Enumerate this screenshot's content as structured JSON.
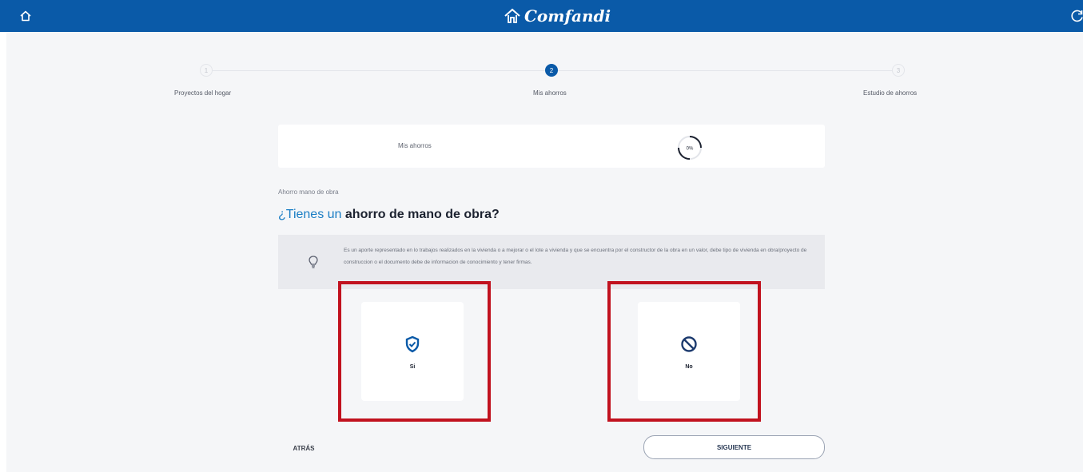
{
  "app": {
    "logo_text": "Comfandi",
    "brand_color": "#0a5aa8",
    "accent_color": "#1a7dc4",
    "highlight_color": "#c1121f"
  },
  "header": {
    "home_icon": "home-icon",
    "refresh_icon": "refresh-icon"
  },
  "stepper": {
    "steps": [
      {
        "number": "1",
        "label": "Proyectos del hogar",
        "state": "pending"
      },
      {
        "number": "2",
        "label": "Mis ahorros",
        "state": "active"
      },
      {
        "number": "3",
        "label": "Estudio de ahorros",
        "state": "pending"
      }
    ]
  },
  "progress": {
    "label": "Mis ahorros",
    "value_text": "0%",
    "fraction": 0.0
  },
  "section": {
    "label": "Ahorro mano de obra",
    "question_highlight": "¿Tienes un",
    "question_rest": " ahorro de mano de obra?"
  },
  "tip": {
    "icon": "lightbulb-icon",
    "text": "Es un aporte representado en lo trabajos realizados en la vivienda o a mejorar o el lote a vivienda y que se encuentra por el constructor de la obra en un valor, debe tipo de vivienda en obra/proyecto de construccion o el documento debe de informacion de conocimiento y tener firmas."
  },
  "options": [
    {
      "label": "Si",
      "icon": "shield-check-icon"
    },
    {
      "label": "No",
      "icon": "ban-icon"
    }
  ],
  "buttons": {
    "back": "ATRÁS",
    "next": "SIGUIENTE"
  }
}
